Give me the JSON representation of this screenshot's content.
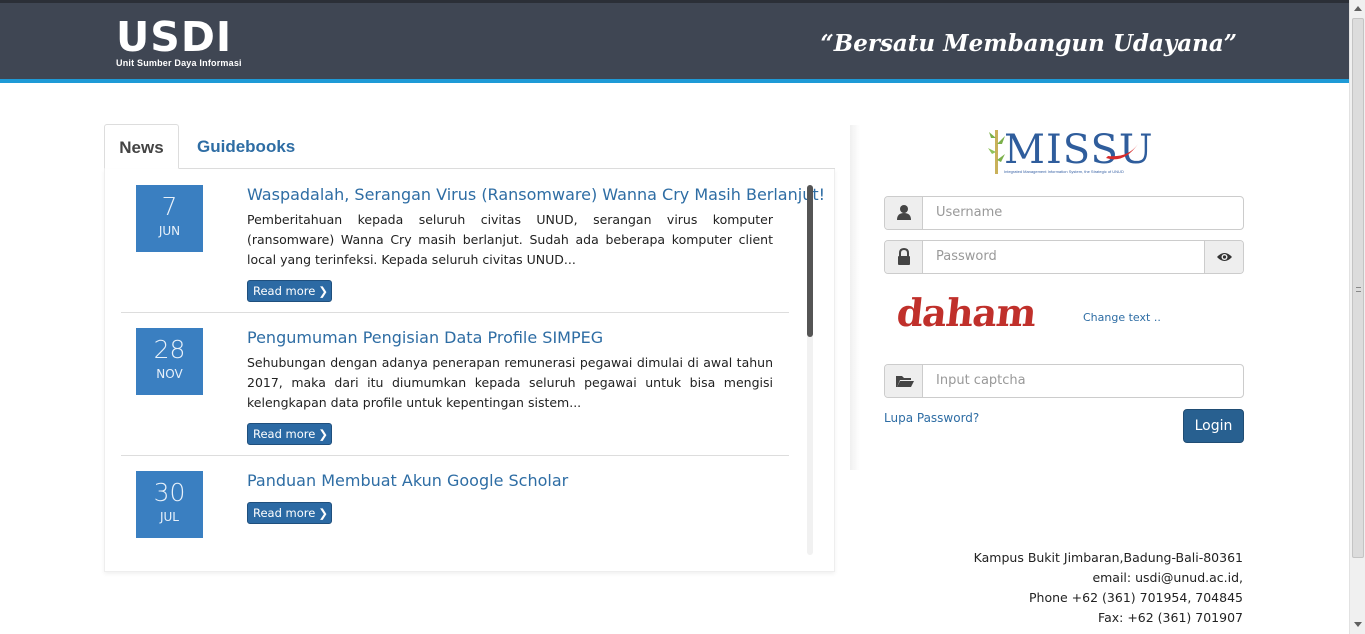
{
  "header": {
    "logo_main": "USDI",
    "logo_sub": "Unit Sumber Daya Informasi",
    "tagline": "“Bersatu Membangun Udayana”"
  },
  "tabs": [
    {
      "label": "News",
      "active": true
    },
    {
      "label": "Guidebooks",
      "active": false
    }
  ],
  "news": [
    {
      "day": "7",
      "month": "JUN",
      "title": "Waspadalah, Serangan Virus (Ransomware) Wanna Cry Masih Berlanjut!",
      "text": "Pemberitahuan kepada seluruh civitas UNUD, serangan virus komputer (ransomware) Wanna Cry masih berlanjut. Sudah ada beberapa komputer client local yang terinfeksi. Kepada seluruh civitas UNUD...",
      "read_more": "Read more"
    },
    {
      "day": "28",
      "month": "NOV",
      "title": "Pengumuman Pengisian Data Profile SIMPEG",
      "text": "Sehubungan dengan adanya penerapan remunerasi pegawai dimulai di awal tahun 2017, maka dari itu diumumkan kepada seluruh pegawai untuk bisa mengisi kelengkapan data profile untuk kepentingan sistem...",
      "read_more": "Read more"
    },
    {
      "day": "30",
      "month": "JUL",
      "title": "Panduan Membuat Akun Google Scholar",
      "text": "",
      "read_more": "Read more"
    }
  ],
  "login": {
    "logo_text": "MISSU",
    "logo_subtitle": "Integrated Management Information System, the Strategic of UNUD",
    "username_placeholder": "Username",
    "password_placeholder": "Password",
    "captcha_text": "daham",
    "change_text": "Change text ..",
    "captcha_placeholder": "Input captcha",
    "forgot_password": "Lupa Password?",
    "login_button": "Login"
  },
  "address": {
    "line1": "Kampus Bukit Jimbaran,Badung-Bali-80361",
    "line2": "email: usdi@unud.ac.id,",
    "line3": "Phone +62 (361) 701954, 704845",
    "line4": "Fax: +62 (361) 701907"
  },
  "icons": {
    "username": "user-icon",
    "password": "lock-icon",
    "reveal": "eye-icon",
    "captcha": "folder-open-icon",
    "read_more": "chevron-right-icon"
  },
  "colors": {
    "header_bg": "#3f4653",
    "header_accent": "#1e9ad6",
    "date_box": "#3a7fc1",
    "link": "#2e6da4",
    "button": "#286090",
    "captcha": "#c0302b"
  }
}
